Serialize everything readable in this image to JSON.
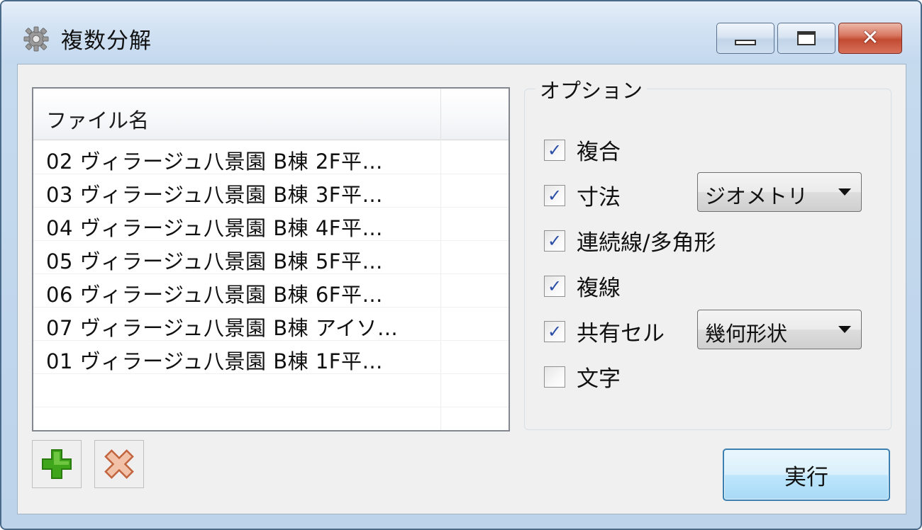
{
  "window": {
    "title": "複数分解",
    "close_glyph": "✕"
  },
  "filelist": {
    "header": "ファイル名",
    "rows": [
      "02  ヴィラージュ八景園  B棟  2F平…",
      "03  ヴィラージュ八景園  B棟  3F平…",
      "04  ヴィラージュ八景園  B棟  4F平…",
      "05  ヴィラージュ八景園  B棟  5F平…",
      "06  ヴィラージュ八景園  B棟  6F平…",
      "07  ヴィラージュ八景園  B棟  アイソ…",
      "01  ヴィラージュ八景園  B棟  1F平…"
    ]
  },
  "options": {
    "legend": "オプション",
    "items": [
      {
        "label": "複合",
        "checked": true
      },
      {
        "label": "寸法",
        "checked": true
      },
      {
        "label": "連続線/多角形",
        "checked": true
      },
      {
        "label": "複線",
        "checked": true
      },
      {
        "label": "共有セル",
        "checked": true
      },
      {
        "label": "文字",
        "checked": false
      }
    ],
    "dimension_combo": "ジオメトリ",
    "shared_cell_combo": "幾何形状"
  },
  "checkmark_glyph": "✓",
  "toolbar": {
    "add_icon": "plus-icon",
    "remove_icon": "remove-x-icon"
  },
  "actions": {
    "execute_label": "実行"
  },
  "colors": {
    "checkmark": "#2a4ea6",
    "add_icon": "#3fa51b",
    "remove_icon": "#d88a6a",
    "exec_border": "#3c7fb1"
  }
}
